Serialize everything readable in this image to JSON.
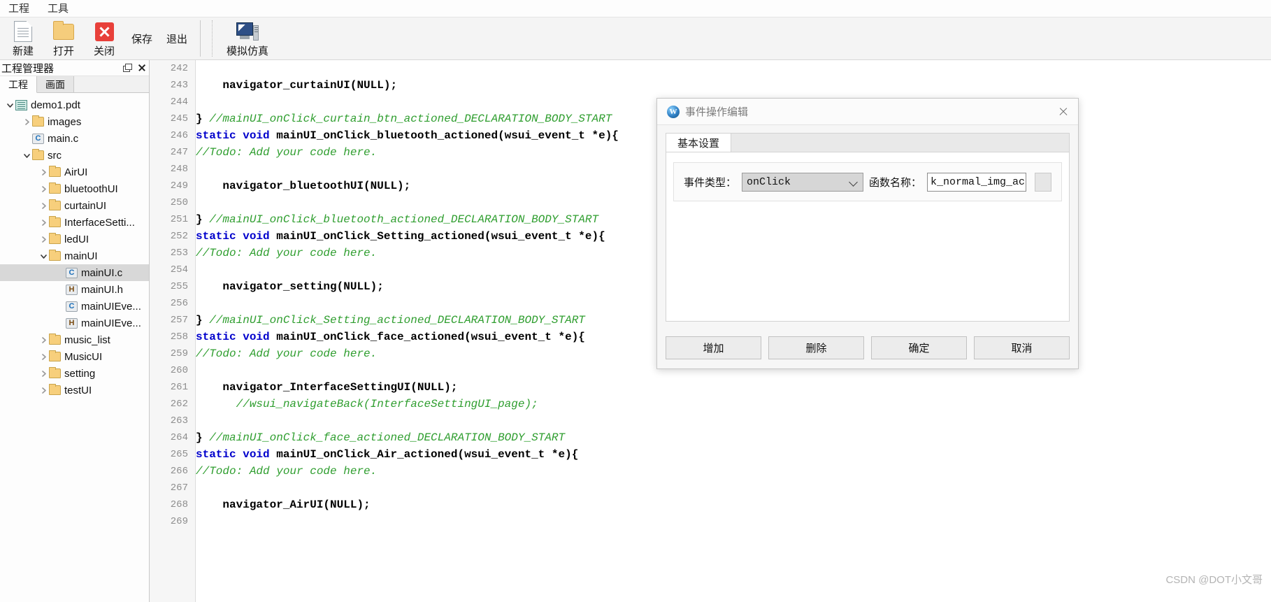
{
  "menubar": {
    "items": [
      {
        "label": "工程"
      },
      {
        "label": "工具"
      }
    ]
  },
  "toolbar": {
    "buttons": [
      {
        "label": "新建",
        "icon": "new-file-icon"
      },
      {
        "label": "打开",
        "icon": "open-folder-icon"
      },
      {
        "label": "关闭",
        "icon": "close-x-icon"
      }
    ],
    "text_buttons": [
      {
        "label": "保存"
      },
      {
        "label": "退出"
      }
    ],
    "sim_button": {
      "label": "模拟仿真",
      "icon": "simulator-monitor-icon"
    }
  },
  "project_panel": {
    "title": "工程管理器",
    "float_icon": "restore-window-icon",
    "close_icon": "close-icon",
    "tabs": [
      {
        "label": "工程",
        "active": true
      },
      {
        "label": "画面",
        "active": false
      }
    ],
    "tree": [
      {
        "indent": 0,
        "arrow": "down",
        "icon": "project-icon",
        "label": "demo1.pdt",
        "selected": false
      },
      {
        "indent": 1,
        "arrow": "right",
        "icon": "folder-icon",
        "label": "images",
        "selected": false
      },
      {
        "indent": 1,
        "arrow": "none",
        "icon": "c-file-icon",
        "label": "main.c",
        "selected": false
      },
      {
        "indent": 1,
        "arrow": "down",
        "icon": "folder-icon",
        "label": "src",
        "selected": false
      },
      {
        "indent": 2,
        "arrow": "right",
        "icon": "folder-icon",
        "label": "AirUI",
        "selected": false
      },
      {
        "indent": 2,
        "arrow": "right",
        "icon": "folder-icon",
        "label": "bluetoothUI",
        "selected": false
      },
      {
        "indent": 2,
        "arrow": "right",
        "icon": "folder-icon",
        "label": "curtainUI",
        "selected": false
      },
      {
        "indent": 2,
        "arrow": "right",
        "icon": "folder-icon",
        "label": "InterfaceSetti...",
        "selected": false
      },
      {
        "indent": 2,
        "arrow": "right",
        "icon": "folder-icon",
        "label": "ledUI",
        "selected": false
      },
      {
        "indent": 2,
        "arrow": "down",
        "icon": "folder-icon",
        "label": "mainUI",
        "selected": false
      },
      {
        "indent": 3,
        "arrow": "none",
        "icon": "c-file-icon",
        "label": "mainUI.c",
        "selected": true
      },
      {
        "indent": 3,
        "arrow": "none",
        "icon": "h-file-icon",
        "label": "mainUI.h",
        "selected": false
      },
      {
        "indent": 3,
        "arrow": "none",
        "icon": "c-file-icon",
        "label": "mainUIEve...",
        "selected": false
      },
      {
        "indent": 3,
        "arrow": "none",
        "icon": "h-file-icon",
        "label": "mainUIEve...",
        "selected": false
      },
      {
        "indent": 2,
        "arrow": "right",
        "icon": "folder-icon",
        "label": "music_list",
        "selected": false
      },
      {
        "indent": 2,
        "arrow": "right",
        "icon": "folder-icon",
        "label": "MusicUI",
        "selected": false
      },
      {
        "indent": 2,
        "arrow": "right",
        "icon": "folder-icon",
        "label": "setting",
        "selected": false
      },
      {
        "indent": 2,
        "arrow": "right",
        "icon": "folder-icon",
        "label": "testUI",
        "selected": false
      }
    ]
  },
  "editor": {
    "first_line_number": 242,
    "lines": [
      {
        "n": 242,
        "tokens": []
      },
      {
        "n": 243,
        "tokens": [
          {
            "t": "    navigator_curtainUI",
            "c": "plain-bold"
          },
          {
            "t": "(NULL);",
            "c": "plain-bold"
          }
        ]
      },
      {
        "n": 244,
        "tokens": []
      },
      {
        "n": 245,
        "tokens": [
          {
            "t": "} ",
            "c": "plain-bold"
          },
          {
            "t": "//mainUI_onClick_curtain_btn_actioned_DECLARATION_BODY_START",
            "c": "comment"
          }
        ]
      },
      {
        "n": 246,
        "tokens": [
          {
            "t": "static void ",
            "c": "keyword"
          },
          {
            "t": "mainUI_onClick_bluetooth_actioned(wsui_event_t *e){",
            "c": "plain-bold"
          }
        ]
      },
      {
        "n": 247,
        "tokens": [
          {
            "t": "//Todo: Add your code here.",
            "c": "comment"
          }
        ]
      },
      {
        "n": 248,
        "tokens": []
      },
      {
        "n": 249,
        "tokens": [
          {
            "t": "    navigator_bluetoothUI(NULL);",
            "c": "plain-bold"
          }
        ]
      },
      {
        "n": 250,
        "tokens": []
      },
      {
        "n": 251,
        "tokens": [
          {
            "t": "} ",
            "c": "plain-bold"
          },
          {
            "t": "//mainUI_onClick_bluetooth_actioned_DECLARATION_BODY_START",
            "c": "comment"
          }
        ]
      },
      {
        "n": 252,
        "tokens": [
          {
            "t": "static void ",
            "c": "keyword"
          },
          {
            "t": "mainUI_onClick_Setting_actioned(wsui_event_t *e){",
            "c": "plain-bold"
          }
        ]
      },
      {
        "n": 253,
        "tokens": [
          {
            "t": "//Todo: Add your code here.",
            "c": "comment"
          }
        ]
      },
      {
        "n": 254,
        "tokens": []
      },
      {
        "n": 255,
        "tokens": [
          {
            "t": "    navigator_setting(NULL);",
            "c": "plain-bold"
          }
        ]
      },
      {
        "n": 256,
        "tokens": []
      },
      {
        "n": 257,
        "tokens": [
          {
            "t": "} ",
            "c": "plain-bold"
          },
          {
            "t": "//mainUI_onClick_Setting_actioned_DECLARATION_BODY_START",
            "c": "comment"
          }
        ]
      },
      {
        "n": 258,
        "tokens": [
          {
            "t": "static void ",
            "c": "keyword"
          },
          {
            "t": "mainUI_onClick_face_actioned(wsui_event_t *e){",
            "c": "plain-bold"
          }
        ]
      },
      {
        "n": 259,
        "tokens": [
          {
            "t": "//Todo: Add your code here.",
            "c": "comment"
          }
        ]
      },
      {
        "n": 260,
        "tokens": []
      },
      {
        "n": 261,
        "tokens": [
          {
            "t": "    navigator_InterfaceSettingUI(NULL);",
            "c": "plain-bold"
          }
        ]
      },
      {
        "n": 262,
        "tokens": [
          {
            "t": "      //wsui_navigateBack(InterfaceSettingUI_page);",
            "c": "comment"
          }
        ]
      },
      {
        "n": 263,
        "tokens": []
      },
      {
        "n": 264,
        "tokens": [
          {
            "t": "} ",
            "c": "plain-bold"
          },
          {
            "t": "//mainUI_onClick_face_actioned_DECLARATION_BODY_START",
            "c": "comment"
          }
        ]
      },
      {
        "n": 265,
        "tokens": [
          {
            "t": "static void ",
            "c": "keyword"
          },
          {
            "t": "mainUI_onClick_Air_actioned(wsui_event_t *e){",
            "c": "plain-bold"
          }
        ]
      },
      {
        "n": 266,
        "tokens": [
          {
            "t": "//Todo: Add your code here.",
            "c": "comment"
          }
        ]
      },
      {
        "n": 267,
        "tokens": []
      },
      {
        "n": 268,
        "tokens": [
          {
            "t": "    navigator_AirUI(NULL);",
            "c": "plain-bold"
          }
        ]
      },
      {
        "n": 269,
        "tokens": []
      }
    ]
  },
  "dialog": {
    "title": "事件操作编辑",
    "logo_icon": "app-logo-icon",
    "close_icon": "close-icon",
    "tabs": [
      {
        "label": "基本设置",
        "active": true
      }
    ],
    "fields": {
      "event_type_label": "事件类型：",
      "event_type_value": "onClick",
      "event_type_chevron": "chevron-down-icon",
      "func_name_label": "函数名称：",
      "func_name_value": "k_normal_img_actioned"
    },
    "buttons": [
      {
        "label": "增加"
      },
      {
        "label": "删除"
      },
      {
        "label": "确定"
      },
      {
        "label": "取消"
      }
    ]
  },
  "watermark": {
    "text": "CSDN @DOT小文哥"
  }
}
